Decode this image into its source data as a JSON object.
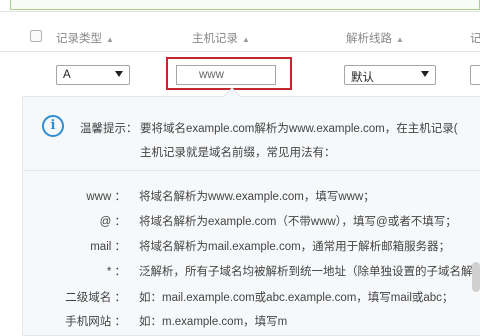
{
  "header": {
    "col_record_type": "记录类型",
    "col_host_record": "主机记录",
    "col_line": "解析线路",
    "col_value_partial": "记",
    "sort_glyph": "▲"
  },
  "row": {
    "record_type_value": "A",
    "host_record_value": "www",
    "line_value": "默认"
  },
  "tip": {
    "title": "温馨提示：",
    "line1": "要将域名example.com解析为www.example.com，在主机记录(",
    "line2": "主机记录就是域名前缀，常见用法有："
  },
  "examples": [
    {
      "key": "www ：",
      "value": "将域名解析为www.example.com，填写www；"
    },
    {
      "key": "@ ：",
      "value": "将域名解析为example.com（不带www），填写@或者不填写；"
    },
    {
      "key": "mail ：",
      "value": "将域名解析为mail.example.com，通常用于解析邮箱服务器；"
    },
    {
      "key": "* ：",
      "value": "泛解析，所有子域名均被解析到统一地址（除单独设置的子域名解"
    },
    {
      "key": "二级域名 ：",
      "value": "如：mail.example.com或abc.example.com，填写mail或abc；"
    },
    {
      "key": "手机网站 ：",
      "value": "如：m.example.com，填写m"
    }
  ],
  "icons": {
    "checkbox": "checkbox-icon",
    "info": "info-icon",
    "dropdown": "chevron-down-icon"
  },
  "colors": {
    "highlight": "#c1272d",
    "info": "#2f8fd5",
    "panel_bg": "#f6f8fa"
  }
}
